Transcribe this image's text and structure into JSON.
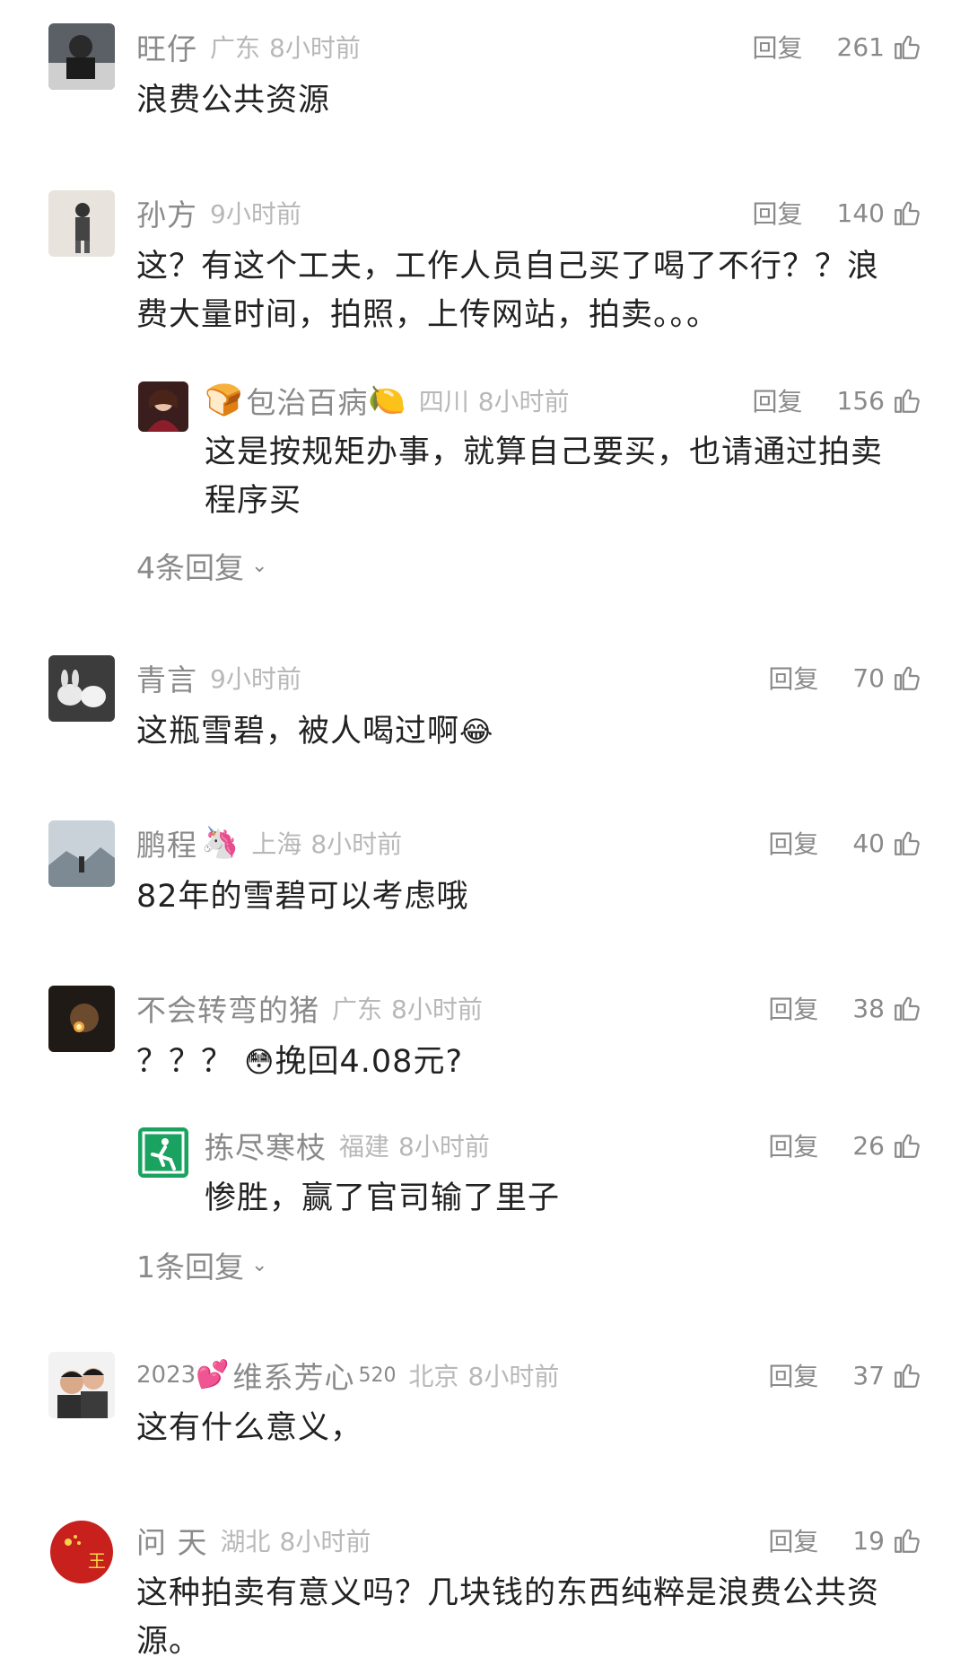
{
  "comments": [
    {
      "name": "旺仔",
      "location": "广东",
      "time": "8小时前",
      "reply": "回复",
      "likes": "261",
      "text": "浪费公共资源"
    },
    {
      "name": "孙方",
      "location": "",
      "time": "9小时前",
      "reply": "回复",
      "likes": "140",
      "text_lines": [
        "这？有这个工夫，工作人员自己买了喝了不行？？浪",
        "费大量时间，拍照，上传网站，拍卖。。。"
      ],
      "sub": {
        "name": "包治百病",
        "location": "四川",
        "time": "8小时前",
        "reply": "回复",
        "likes": "156",
        "text_lines": [
          "这是按规矩办事，就算自己要买，也请通过拍卖",
          "程序买"
        ]
      },
      "more": "4条回复"
    },
    {
      "name": "青言",
      "location": "",
      "time": "9小时前",
      "reply": "回复",
      "likes": "70",
      "text": "这瓶雪碧，被人喝过啊"
    },
    {
      "name": "鹏程",
      "location": "上海",
      "time": "8小时前",
      "reply": "回复",
      "likes": "40",
      "text": "82年的雪碧可以考虑哦"
    },
    {
      "name": "不会转弯的猪",
      "location": "广东",
      "time": "8小时前",
      "reply": "回复",
      "likes": "38",
      "text_a": "？？？",
      "text_b": "挽回4.08元?",
      "sub": {
        "name": "拣尽寒枝",
        "location": "福建",
        "time": "8小时前",
        "reply": "回复",
        "likes": "26",
        "text": "惨胜，赢了官司输了里子"
      },
      "more": "1条回复"
    },
    {
      "name_prefix": "2023",
      "name": "维系芳心",
      "name_suffix": "520",
      "location": "北京",
      "time": "8小时前",
      "reply": "回复",
      "likes": "37",
      "text": "这有什么意义，"
    },
    {
      "name": "问 天",
      "location": "湖北",
      "time": "8小时前",
      "reply": "回复",
      "likes": "19",
      "text_lines": [
        "这种拍卖有意义吗？几块钱的东西纯粹是浪费公共资",
        "源。"
      ]
    }
  ],
  "icons": {
    "thumb": "thumbs-up-icon",
    "chevron": "chevron-down-icon",
    "bread": "bread-emoji",
    "lemon": "lemon-emoji",
    "unicorn": "unicorn-emoji",
    "laugh": "laughing-crying-emoji",
    "flushed": "flushed-face-emoji",
    "heart": "two-hearts-emoji"
  },
  "colors": {
    "name": "#8a8a8a",
    "meta": "#b8b8b8",
    "text": "#222222",
    "background": "#ffffff"
  }
}
